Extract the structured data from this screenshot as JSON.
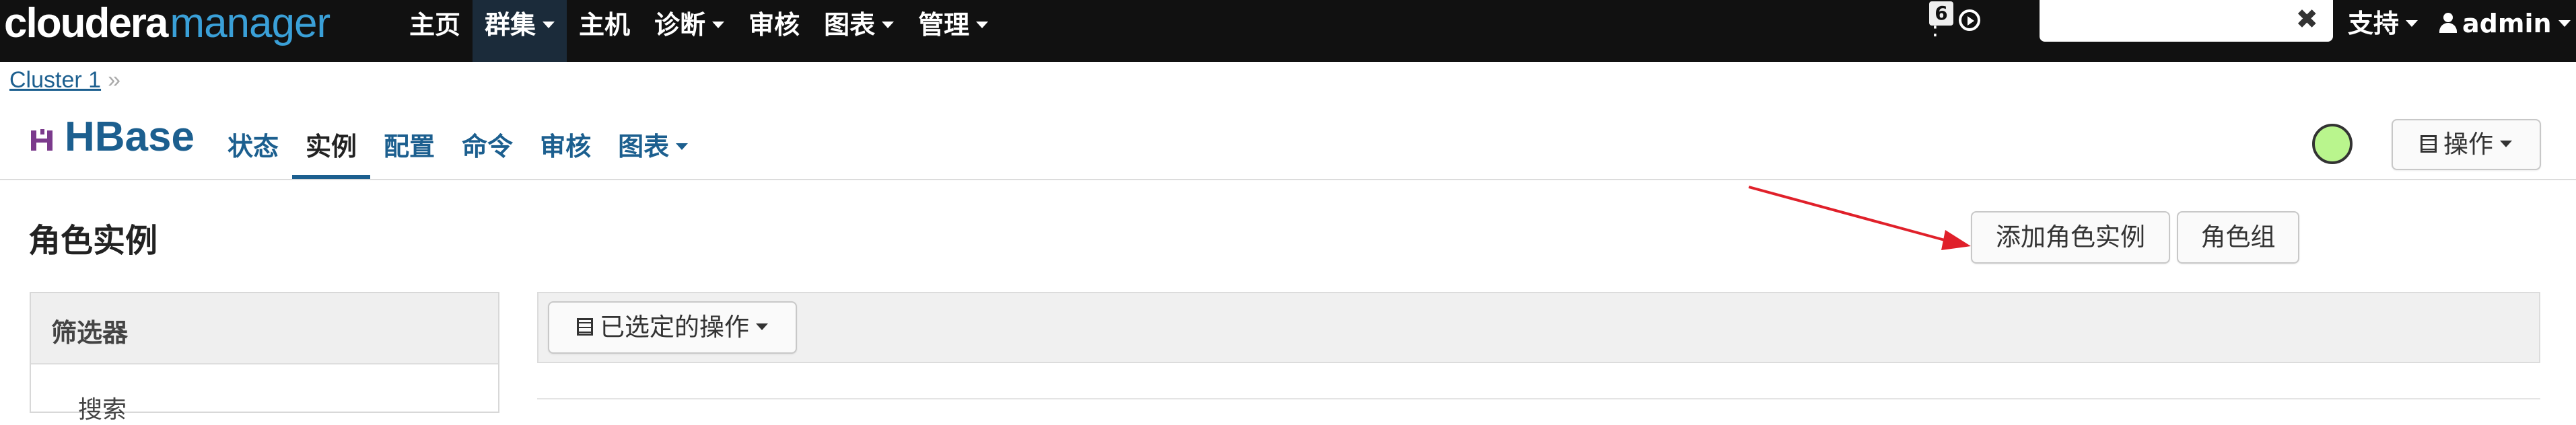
{
  "app": {
    "brand_bold": "cloudera",
    "brand_light": "manager"
  },
  "topnav": {
    "items": [
      {
        "label": "主页"
      },
      {
        "label": "群集"
      },
      {
        "label": "主机"
      },
      {
        "label": "诊断"
      },
      {
        "label": "审核"
      },
      {
        "label": "图表"
      },
      {
        "label": "管理"
      }
    ],
    "tasks_badge": "6",
    "search_value": "",
    "support_label": "支持",
    "user_label": "admin"
  },
  "breadcrumb": {
    "cluster": "Cluster 1",
    "separator": "»"
  },
  "service": {
    "name": "HBase",
    "tabs": [
      {
        "label": "状态"
      },
      {
        "label": "实例"
      },
      {
        "label": "配置"
      },
      {
        "label": "命令"
      },
      {
        "label": "审核"
      },
      {
        "label": "图表"
      }
    ],
    "active_tab": "实例",
    "health_color": "#b9f58d",
    "actions_label": "操作"
  },
  "main": {
    "title": "角色实例",
    "add_role_instances_label": "添加角色实例",
    "role_groups_label": "角色组",
    "filter_title": "筛选器",
    "filter_search_label": "搜索",
    "selected_actions_label": "已选定的操作"
  },
  "colors": {
    "navbar": "#111111",
    "link": "#1c5f8f",
    "brand_accent": "#3aa0d8",
    "annotation_arrow": "#e0202a"
  }
}
